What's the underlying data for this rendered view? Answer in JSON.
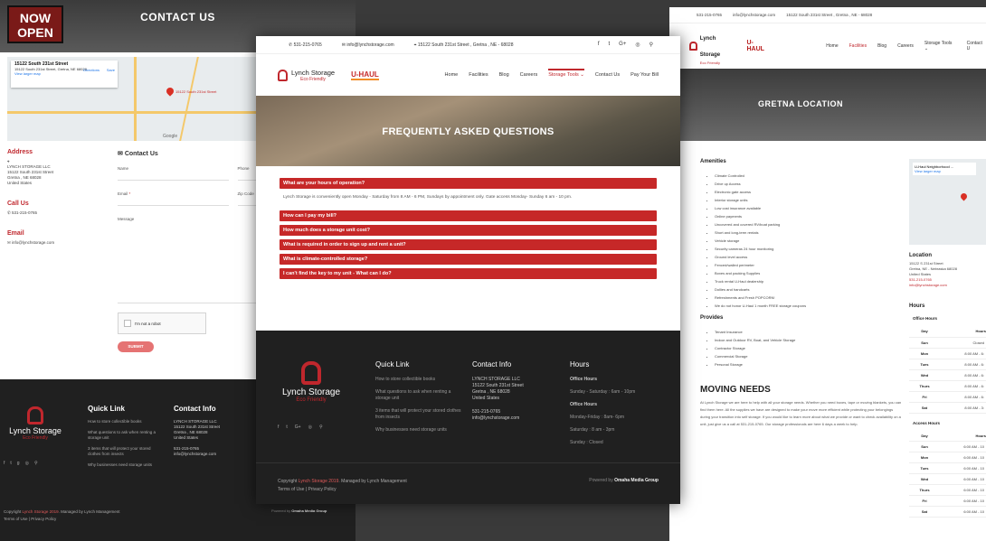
{
  "contact_page": {
    "hero_sign": "NOW OPEN",
    "hero_title": "CONTACT US",
    "map": {
      "place_name": "15122 South 231st Street",
      "place_addr": "15122 South 231st Street, Gretna, NE 68028",
      "larger_map": "View larger map",
      "directions": "Directions",
      "save": "Save",
      "pin_label": "15122 South 231st Street",
      "google": "Google"
    },
    "address": {
      "heading": "Address",
      "lines": [
        "LYNCH STORAGE LLC",
        "15122 South 231st Street",
        "Gretna , NE 68028",
        "United States"
      ]
    },
    "call": {
      "heading": "Call Us",
      "phone": "531-215-0765"
    },
    "email": {
      "heading": "Email",
      "address": "info@lynchstorage.com"
    },
    "form": {
      "heading": "Contact Us",
      "name": "Name",
      "phone": "Phone",
      "email": "Email",
      "zip": "Zip Code",
      "message": "Message",
      "captcha": "I'm not a robot",
      "submit": "SUBMIT"
    },
    "footer": {
      "brand": "Lynch Storage",
      "tagline": "Eco Friendly",
      "quick_title": "Quick Link",
      "links": [
        "How to store collectible books",
        "What questions to ask when renting a storage unit",
        "3 items that will protect your stored clothes from insects",
        "Why businesses need storage units"
      ],
      "contact_title": "Contact Info",
      "contact_lines": [
        "LYNCH STORAGE LLC",
        "15122 South 231st Street",
        "Gretna , NE 68028",
        "United States"
      ],
      "phone": "531-215-0765",
      "email": "info@lynchstorage.com",
      "copy_prefix": "Copyright",
      "copy_brand": "Lynch Storage 2019",
      "copy_suffix": ". Managed by Lynch Management",
      "terms": "Terms of Use",
      "privacy": "Privacy Policy",
      "powered": "Powered by",
      "powered_by": "Omaha Media Group"
    }
  },
  "faq_page": {
    "topbar": {
      "phone": "531-215-0765",
      "email": "info@lynchstorage.com",
      "address": "15122 South 231st Street , Gretna , NE - 68028"
    },
    "brand": "Lynch Storage",
    "tagline": "Eco Friendly",
    "uhaul": "U-HAUL",
    "menu": [
      "Home",
      "Facilities",
      "Blog",
      "Careers",
      "Storage Tools",
      "Contact Us",
      "Pay Your Bill"
    ],
    "hero_title": "FREQUENTLY ASKED QUESTIONS",
    "faqs": [
      {
        "q": "What are your hours of operation?",
        "a": "Lynch Storage  is conveniently open Monday - Saturday from 8 AM - 6 PM, Sundays by appointment only.  Gate access Monday- Sunday 6 am - 10 pm."
      },
      {
        "q": "How can I pay my bill?"
      },
      {
        "q": "How much does a storage unit cost?"
      },
      {
        "q": "What is required in order to sign up and rent a unit?"
      },
      {
        "q": "What is climate-controlled storage?"
      },
      {
        "q": "I can't find the key to my unit - What can I do?"
      }
    ],
    "footer": {
      "brand": "Lynch Storage",
      "tagline": "Eco Friendly",
      "quick_title": "Quick Link",
      "links": [
        "How to store collectible books",
        "What questions to ask when renting a storage unit",
        "3 items that will protect your stored clothes from insects",
        "Why businesses need storage units"
      ],
      "contact_title": "Contact Info",
      "contact_lines": [
        "LYNCH STORAGE LLC",
        "15122 South 231st Street",
        "Gretna , NE 68028",
        "United States"
      ],
      "phone": "531-215-0765",
      "email": "info@lynchstorage.com",
      "hours_title": "Hours",
      "office_hours": "Office Hours",
      "office_1": "Sunday - Saturday : 6am - 10pm",
      "access_hours": "Office Hours",
      "access_1": "Monday-Friday : 8am- 6pm",
      "access_2": "Saturday : 8 am - 3pm",
      "access_3": "Sunday : Closed",
      "copy_prefix": "Copyright",
      "copy_brand": "Lynch Storage 2019",
      "copy_suffix": ". Managed by Lynch Management",
      "terms": "Terms of Use",
      "privacy": "Privacy Policy",
      "powered": "Powered by",
      "powered_by": "Omaha Media Group"
    }
  },
  "location_page": {
    "topbar": {
      "phone": "531-215-0765",
      "email": "info@lynchstorage.com",
      "address": "15122 South 231st Street , Gretna , NE - 68028"
    },
    "brand": "Lynch Storage",
    "tagline": "Eco Friendly",
    "uhaul": "U-HAUL",
    "menu": [
      "Home",
      "Facilities",
      "Blog",
      "Careers",
      "Storage Tools",
      "Contact U"
    ],
    "hero_title": "GRETNA LOCATION",
    "amenities_title": "Amenities",
    "amenities": [
      "Climate Controlled",
      "Drive up Access",
      "Electronic gate access",
      "Interior storage units",
      "Low cost insurance available",
      "Online payments",
      "Uncovered and covered RV/boat parking",
      "Short and long-term rentals",
      "Vehicle storage",
      "Security cameras 24 hour monitoring",
      "Ground level access",
      "Fenced/walled perimeter",
      "Boxes and packing Supplies",
      "Truck rental U-Haul dealership",
      "Dollies and handcarts",
      "Refreshments and Fresh POPCORN!",
      "We do not honor U-Haul 1 month FREE storage coupons"
    ],
    "provides_title": "Provides",
    "provides": [
      "Tenant Insurance",
      "Indoor and Outdoor RV, Boat, and Vehicle Storage",
      "Contractor Storage",
      "Commercial Storage",
      "Personal Storage"
    ],
    "moving_title": "MOVING NEEDS",
    "moving_text": "At Lynch Storage we are here to help with all your storage needs. Whether you need boxes, tape or moving blankets, you can find them here. All the supplies we have are designed to make your move more efficient while protecting your belongings during your transition into self storage. If you would like to learn more about what we provide or want to check availability on a unit, just give us a call at 531-215-0765. Our storage professionals are here 6 days a week to help.",
    "map": {
      "place": "U-Haul Neighborhood ...",
      "larger": "View larger map"
    },
    "location_title": "Location",
    "location_lines": [
      "15122 S 231st Street",
      "Gretna, NE - Nebraska 68028",
      "United States"
    ],
    "location_phone": "531-215-0765",
    "location_email": "info@lynchstorage.com",
    "hours_title": "Hours",
    "office_hours_title": "Office Hours",
    "access_hours_title": "Access Hours",
    "col_day": "Day",
    "col_hours": "Hours",
    "office_hours": [
      {
        "day": "Sun",
        "hours": "Closed"
      },
      {
        "day": "Mon",
        "hours": "8:00 AM - 6:"
      },
      {
        "day": "Tues",
        "hours": "8:00 AM - 6:"
      },
      {
        "day": "Wed",
        "hours": "8:00 AM - 6:"
      },
      {
        "day": "Thurs",
        "hours": "8:00 AM - 6:"
      },
      {
        "day": "Fri",
        "hours": "8:00 AM - 6:"
      },
      {
        "day": "Sat",
        "hours": "8:00 AM - 3:"
      }
    ],
    "access_hours": [
      {
        "day": "Sun",
        "hours": "6:00 AM - 10"
      },
      {
        "day": "Mon",
        "hours": "6:00 AM - 10"
      },
      {
        "day": "Tues",
        "hours": "6:00 AM - 10"
      },
      {
        "day": "Wed",
        "hours": "6:00 AM - 10"
      },
      {
        "day": "Thurs",
        "hours": "6:00 AM - 10"
      },
      {
        "day": "Fri",
        "hours": "6:00 AM - 10"
      },
      {
        "day": "Sat",
        "hours": "6:00 AM - 10"
      }
    ]
  },
  "colors": {
    "brand_red": "#c62828",
    "dark_footer": "#202020"
  }
}
